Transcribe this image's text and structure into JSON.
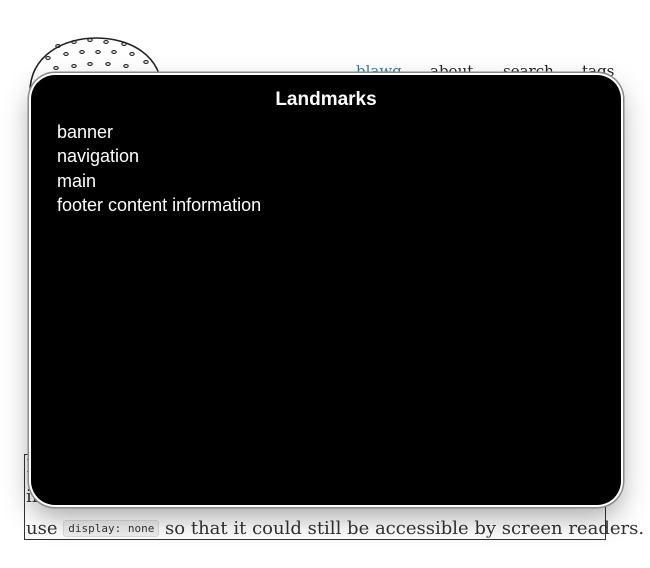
{
  "site": {
    "nav": {
      "items": [
        {
          "label": "blawg",
          "active": true
        },
        {
          "label": "about",
          "active": false
        },
        {
          "label": "search",
          "active": false
        },
        {
          "label": "tags",
          "active": false
        }
      ],
      "active_color": "#3a7ca5"
    },
    "content": {
      "line_start_fragment": "I",
      "line2_fragment": "in",
      "line3_prefix": "use",
      "line3_code": "display: none",
      "line3_suffix": "so that it could still be accessible by screen readers."
    }
  },
  "landmarks_overlay": {
    "title": "Landmarks",
    "items": [
      "banner",
      "navigation",
      "main",
      "footer content information"
    ]
  }
}
